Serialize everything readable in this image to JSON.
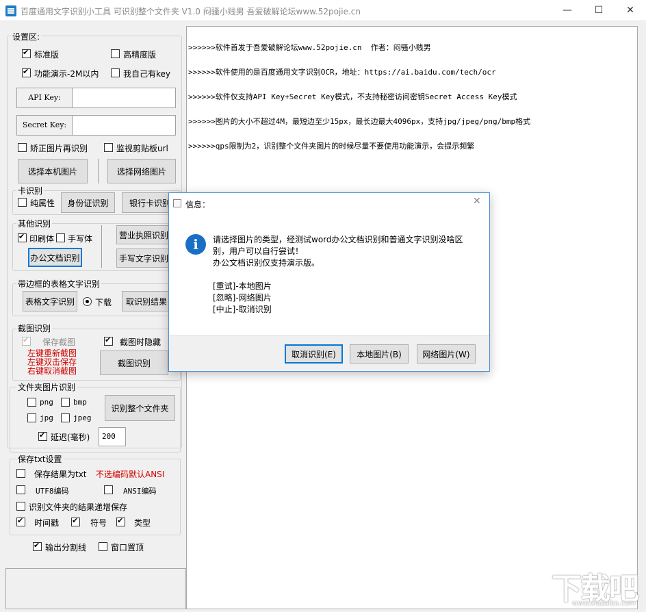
{
  "window": {
    "title": "百度通用文字识别小工具 可识别整个文件夹 V1.0  闷骚小贱男    吾爱破解论坛www.52pojie.cn",
    "minimize": "—",
    "maximize": "☐",
    "close": "✕"
  },
  "settings": {
    "group_label": "设置区:",
    "standard": "标准版",
    "high_precision": "高精度版",
    "demo": "功能演示-2M以内",
    "own_key": "我自己有key",
    "api_key_label": "API Key:",
    "secret_key_label": "Secret Key:",
    "correct_image": "矫正图片再识别",
    "monitor_clipboard": "监视剪贴板url",
    "select_local": "选择本机图片",
    "select_network": "选择网络图片"
  },
  "card": {
    "group_label": "卡识别",
    "pure_attr": "纯属性",
    "id_card": "身份证识别",
    "bank_card": "银行卡识别"
  },
  "other": {
    "group_label": "其他识别",
    "print": "印刷体",
    "handwriting": "手写体",
    "business_license": "营业执照识别",
    "office_doc": "办公文档识别",
    "handwriting_text": "手写文字识别"
  },
  "table": {
    "group_label": "带边框的表格文字识别",
    "table_text": "表格文字识别",
    "download": "下载",
    "get_result": "取识别结果"
  },
  "screenshot": {
    "group_label": "截图识别",
    "save_shot": "保存截图",
    "hide_on_shot": "截图时隐藏",
    "hint1": "左键重新截图",
    "hint2": "左键双击保存",
    "hint3": "右键取消截图",
    "shot_recognize": "截图识别"
  },
  "folder": {
    "group_label": "文件夹图片识别",
    "png": "png",
    "bmp": "bmp",
    "jpg": "jpg",
    "jpeg": "jpeg",
    "recognize_folder": "识别整个文件夹",
    "delay": "延迟(毫秒)",
    "delay_value": "200"
  },
  "save": {
    "group_label": "保存txt设置",
    "save_as_txt": "保存结果为txt",
    "default_ansi": "不选编码默认ANSI",
    "utf8": "UTF8编码",
    "ansi": "ANSI编码",
    "incremental": "识别文件夹的结果递增保存",
    "timestamp": "时间戳",
    "symbol": "符号",
    "type": "类型"
  },
  "bottom": {
    "output_divider": "输出分割线",
    "window_top": "窗口置顶"
  },
  "log": {
    "lines": [
      ">>>>>>软件首发于吾爱破解论坛www.52pojie.cn  作者：闷骚小贱男",
      ">>>>>>软件使用的是百度通用文字识别OCR，地址：https://ai.baidu.com/tech/ocr",
      ">>>>>>软件仅支持API Key+Secret Key模式，不支持秘密访问密钥Secret Access Key模式",
      ">>>>>>图片的大小不超过4M，最短边至少15px，最长边最大4096px，支持jpg/jpeg/png/bmp格式",
      ">>>>>>qps限制为2，识别整个文件夹图片的时候尽量不要使用功能演示，会提示频繁"
    ]
  },
  "dialog": {
    "title": "信息：",
    "icon": "i",
    "close": "✕",
    "msg1": "请选择图片的类型，经测试word办公文档识别和普通文字识别没啥区",
    "msg2": "别，用户可以自行尝试！",
    "msg3": "办公文档识别仅支持演示版。",
    "opt1": "[重试]-本地图片",
    "opt2": "[忽略]-网络图片",
    "opt3": "[中止]-取消识别",
    "cancel_btn": "取消识别(E)",
    "local_btn": "本地图片(B)",
    "network_btn": "网络图片(W)"
  },
  "watermark": {
    "main": "下载吧",
    "sub": "www.xiazaiba.com"
  }
}
